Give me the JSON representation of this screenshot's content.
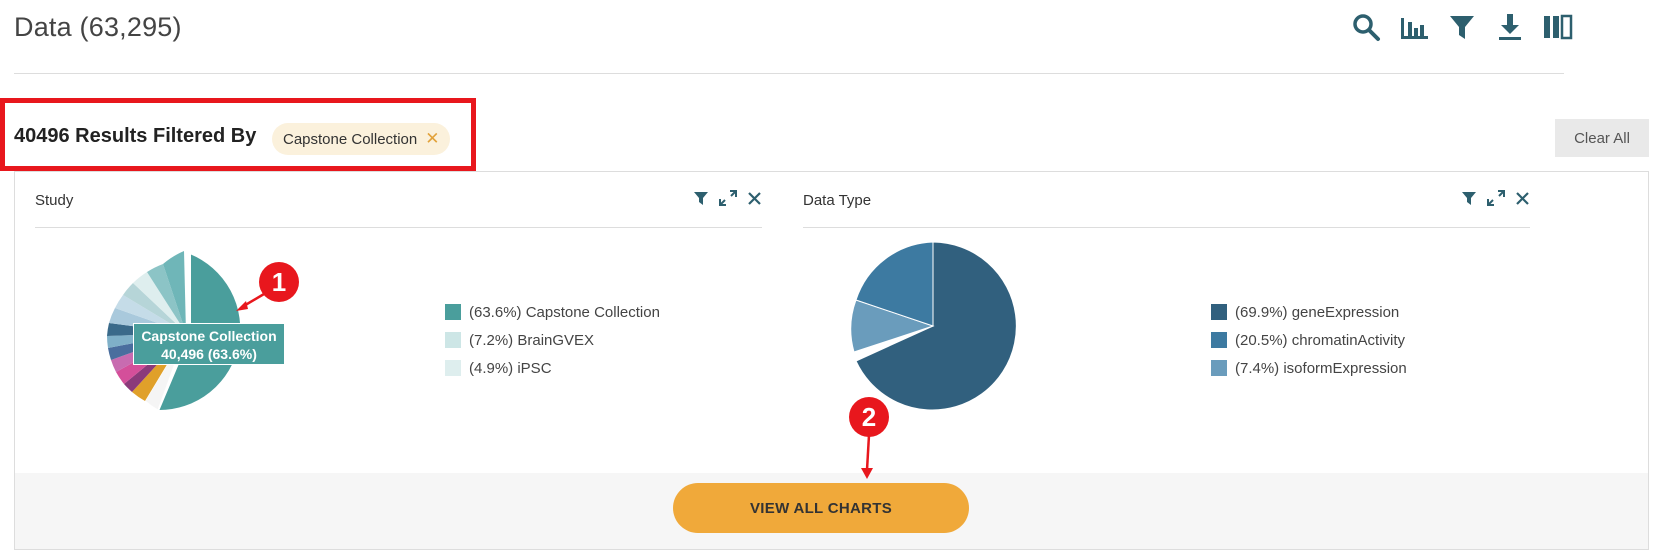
{
  "header": {
    "title": "Data (63,295)",
    "toolbar": [
      {
        "icon": "search-icon"
      },
      {
        "icon": "bar-chart-icon"
      },
      {
        "icon": "filter-icon"
      },
      {
        "icon": "download-icon"
      },
      {
        "icon": "columns-icon"
      }
    ]
  },
  "filter": {
    "summary": "40496 Results Filtered By",
    "chip_label": "Capstone Collection",
    "chip_remove": "✕",
    "clear_all": "Clear All"
  },
  "study_card": {
    "title": "Study",
    "tooltip_name": "Capstone Collection",
    "tooltip_value": "40,496 (63.6%)",
    "legend": [
      {
        "label": "(63.6%) Capstone Collection",
        "color": "#4a9e9c"
      },
      {
        "label": "(7.2%) BrainGVEX",
        "color": "#cde6e6"
      },
      {
        "label": "(4.9%) iPSC",
        "color": "#deeeee"
      }
    ]
  },
  "datatype_card": {
    "title": "Data Type",
    "legend": [
      {
        "label": "(69.9%) geneExpression",
        "color": "#31607e"
      },
      {
        "label": "(20.5%) chromatinActivity",
        "color": "#3d7aa1"
      },
      {
        "label": "(7.4%) isoformExpression",
        "color": "#6a9cbc"
      }
    ]
  },
  "footer": {
    "view_all_label": "VIEW ALL CHARTS"
  },
  "annotations": {
    "callout_1": "1",
    "callout_2": "2"
  },
  "colors": {
    "highlight": "#e8171d",
    "accent": "#f0a93a",
    "teal": "#4a9e9c",
    "navy": "#31607e"
  }
}
